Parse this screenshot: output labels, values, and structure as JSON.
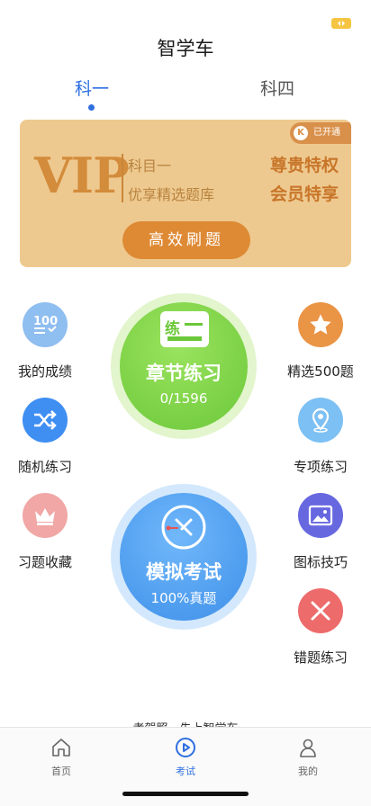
{
  "app": {
    "title": "智学车"
  },
  "tabs": [
    {
      "label": "科一",
      "active": true
    },
    {
      "label": "科四",
      "active": false
    }
  ],
  "vip": {
    "badge_text": "已开通",
    "badge_icon": "K",
    "big_text": "VIP",
    "subtitle_1": "科目一",
    "subtitle_2": "优享精选题库",
    "right_1": "尊贵特权",
    "right_2": "会员特享",
    "button_label": "高效刷题"
  },
  "left_menu": [
    {
      "label": "我的成绩",
      "icon": "score-100-icon"
    },
    {
      "label": "随机练习",
      "icon": "shuffle-icon"
    },
    {
      "label": "习题收藏",
      "icon": "crown-icon"
    }
  ],
  "right_menu": [
    {
      "label": "精选500题",
      "icon": "star-icon"
    },
    {
      "label": "专项练习",
      "icon": "location-pin-icon"
    },
    {
      "label": "图标技巧",
      "icon": "image-icon"
    },
    {
      "label": "错题练习",
      "icon": "close-icon"
    }
  ],
  "chapter_practice": {
    "icon_text": "练",
    "title": "章节练习",
    "progress": "0/1596"
  },
  "mock_exam": {
    "title": "模拟考试",
    "subtitle": "100%真题"
  },
  "footer_note": "考驾照，先上智学车",
  "bottom_nav": [
    {
      "label": "首页",
      "active": false,
      "icon": "home-icon"
    },
    {
      "label": "考试",
      "active": true,
      "icon": "play-circle-icon"
    },
    {
      "label": "我的",
      "active": false,
      "icon": "user-icon"
    }
  ],
  "colors": {
    "accent_blue": "#2f6fe0",
    "vip_bg": "#eec98f",
    "vip_button": "#de8a35",
    "green_circle": "#6cc83a",
    "blue_circle": "#3d8fe8"
  }
}
